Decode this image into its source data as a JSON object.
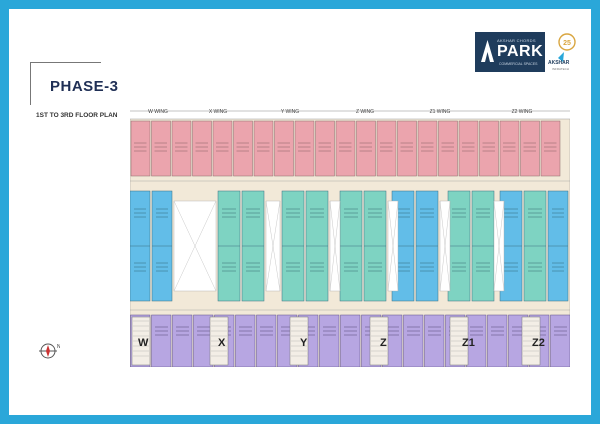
{
  "header": {
    "phase_title": "PHASE-3",
    "floor_range": "1ST TO 3RD FLOOR PLAN"
  },
  "brand": {
    "developer": "AKSHAR CHORDS",
    "project": "PARK",
    "tagline": "COMMERCIAL SPACES",
    "partner": "AKSHAR",
    "partner_sub": "INFRATECH"
  },
  "wings": [
    "W WING",
    "X WING",
    "Y WING",
    "Z WING",
    "Z1 WING",
    "Z2 WING"
  ],
  "wing_markers": [
    "W",
    "X",
    "Y",
    "Z",
    "Z1",
    "Z2"
  ],
  "colors": {
    "frame": "#2aa7d9",
    "pink": "#eba4ad",
    "blue": "#62bde8",
    "teal": "#7ed3c2",
    "purple": "#b7a6e2",
    "corridor": "#f2e9d8",
    "logo_bg": "#1f3c5c"
  }
}
